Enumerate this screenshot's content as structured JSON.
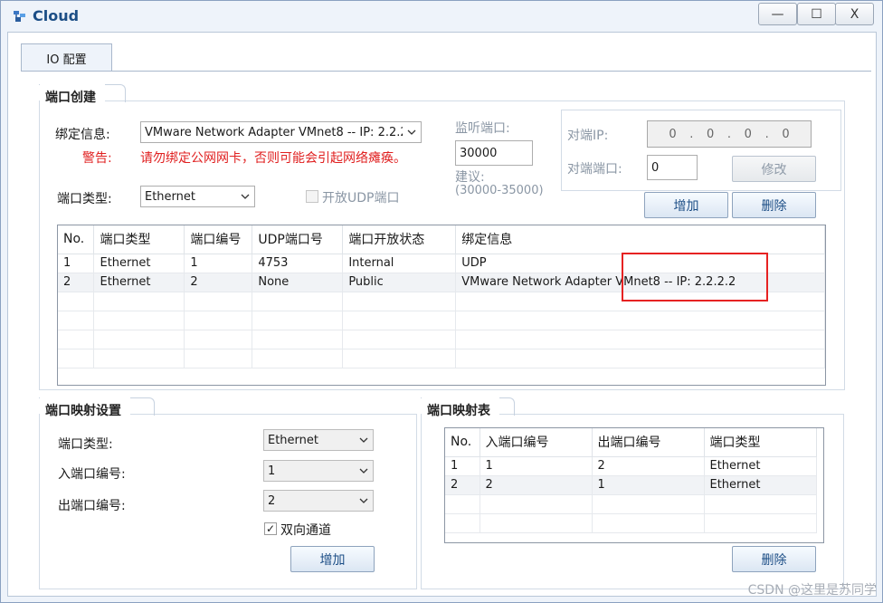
{
  "window": {
    "title": "Cloud",
    "buttons": {
      "minimize": "—",
      "maximize": "☐",
      "close": "X"
    }
  },
  "tabs": [
    {
      "label": "IO 配置"
    }
  ],
  "port_create": {
    "group_title": "端口创建",
    "bind_info_label": "绑定信息:",
    "bind_info_value": "VMware Network Adapter VMnet8 -- IP: 2.2.2.2",
    "warning_label": "警告:",
    "warning_text": "请勿绑定公网网卡，否则可能会引起网络瘫痪。",
    "port_type_label": "端口类型:",
    "port_type_value": "Ethernet",
    "listen_port_label": "监听端口:",
    "listen_port_value": "30000",
    "suggest_label": "建议:",
    "suggest_range": "(30000-35000)",
    "open_udp_label": "开放UDP端口",
    "peer_ip_label": "对端IP:",
    "peer_ip_octets": [
      "0",
      "0",
      "0",
      "0"
    ],
    "peer_port_label": "对端端口:",
    "peer_port_value": "0",
    "modify_button": "修改",
    "add_button": "增加",
    "delete_button": "删除",
    "table": {
      "columns": [
        "No.",
        "端口类型",
        "端口编号",
        "UDP端口号",
        "端口开放状态",
        "绑定信息"
      ],
      "rows": [
        [
          "1",
          "Ethernet",
          "1",
          "4753",
          "Internal",
          "UDP"
        ],
        [
          "2",
          "Ethernet",
          "2",
          "None",
          "Public",
          "VMware Network Adapter VMnet8 -- IP: 2.2.2.2"
        ]
      ]
    }
  },
  "port_mapping_settings": {
    "group_title": "端口映射设置",
    "port_type_label": "端口类型:",
    "port_type_value": "Ethernet",
    "in_port_label": "入端口编号:",
    "in_port_value": "1",
    "out_port_label": "出端口编号:",
    "out_port_value": "2",
    "bidirectional_label": "双向通道",
    "bidirectional_checked": "✓",
    "add_button": "增加"
  },
  "port_mapping_table": {
    "group_title": "端口映射表",
    "columns": [
      "No.",
      "入端口编号",
      "出端口编号",
      "端口类型"
    ],
    "rows": [
      [
        "1",
        "1",
        "2",
        "Ethernet"
      ],
      [
        "2",
        "2",
        "1",
        "Ethernet"
      ]
    ],
    "delete_button": "删除"
  },
  "watermark": "CSDN @这里是苏同学",
  "colors": {
    "accent": "#1c4e86",
    "warning": "#e02020",
    "highlight_box": "#e62222"
  }
}
